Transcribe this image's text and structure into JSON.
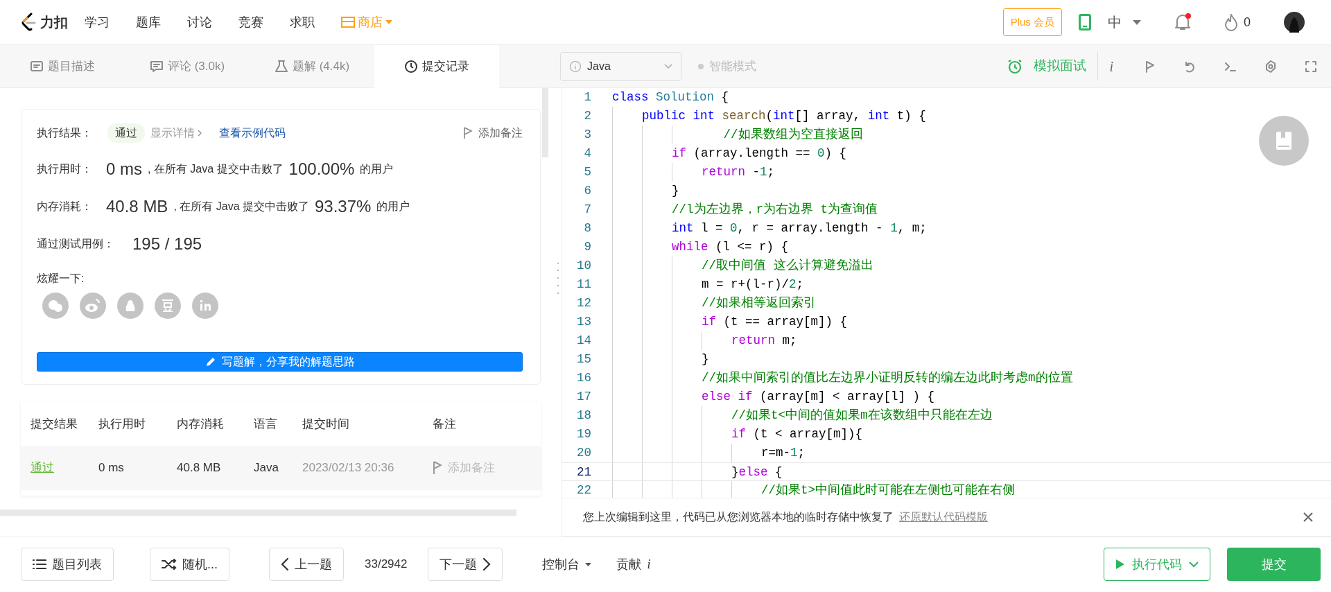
{
  "nav": {
    "logo_text": "力扣",
    "links": [
      {
        "label": "学习"
      },
      {
        "label": "题库"
      },
      {
        "label": "讨论"
      },
      {
        "label": "竞赛"
      },
      {
        "label": "求职"
      }
    ],
    "store": "商店",
    "plus": "Plus 会员",
    "lang": {
      "label": "中",
      "expanded": false
    },
    "bell_unread": true,
    "fire_count": "0"
  },
  "left_tabs": [
    {
      "label": "题目描述",
      "selected": false
    },
    {
      "label": "评论 (3.0k)",
      "selected": false
    },
    {
      "label": "题解 (4.4k)",
      "selected": false
    },
    {
      "label": "提交记录",
      "selected": true
    }
  ],
  "editor_toolbar": {
    "language": "Java",
    "smart_mode": "智能模式",
    "interview": "模拟面试",
    "info": "i"
  },
  "result": {
    "status_label": "执行结果：",
    "status": "通过",
    "details": "显示详情",
    "sample_link": "查看示例代码",
    "note": "添加备注",
    "runtime": {
      "label": "执行用时：",
      "value": "0 ms",
      "text": ", 在所有 Java 提交中击败了",
      "percent": "100.00%",
      "suffix": "的用户"
    },
    "memory": {
      "label": "内存消耗：",
      "value": "40.8 MB",
      "text": ", 在所有 Java 提交中击败了",
      "percent": "93.37%",
      "suffix": "的用户"
    },
    "tests": {
      "label": "通过测试用例：",
      "value": "195 / 195"
    },
    "share_label": "炫耀一下:",
    "write_button": "写题解，分享我的解题思路"
  },
  "submissions": {
    "columns": [
      "提交结果",
      "执行用时",
      "内存消耗",
      "语言",
      "提交时间",
      "备注"
    ],
    "rows": [
      {
        "result": "通过",
        "runtime": "0 ms",
        "memory": "40.8 MB",
        "language": "Java",
        "time": "2023/02/13 20:36",
        "note": "添加备注"
      }
    ]
  },
  "code": {
    "lines": [
      {
        "number": "1",
        "current": false,
        "tokens": [
          {
            "kind": "keyword",
            "text": "class"
          },
          {
            "kind": "type",
            "text": " Solution"
          },
          {
            "kind": "plain",
            "text": " {"
          }
        ]
      },
      {
        "number": "2",
        "current": false,
        "tokens": [
          {
            "kind": "keyword",
            "text": "    public"
          },
          {
            "kind": "keyword",
            "text": " int"
          },
          {
            "kind": "function",
            "text": " search"
          },
          {
            "kind": "plain",
            "text": "("
          },
          {
            "kind": "keyword",
            "text": "int"
          },
          {
            "kind": "plain",
            "text": "[] array, "
          },
          {
            "kind": "keyword",
            "text": "int"
          },
          {
            "kind": "plain",
            "text": " t) {"
          }
        ]
      },
      {
        "number": "3",
        "current": false,
        "tokens": [
          {
            "kind": "comment",
            "text": "               //如果数组为空直接返回"
          }
        ]
      },
      {
        "number": "4",
        "current": false,
        "tokens": [
          {
            "kind": "control",
            "text": "        if"
          },
          {
            "kind": "plain",
            "text": " (array.length == "
          },
          {
            "kind": "number",
            "text": "0"
          },
          {
            "kind": "plain",
            "text": ") {"
          }
        ]
      },
      {
        "number": "5",
        "current": false,
        "tokens": [
          {
            "kind": "control",
            "text": "            return"
          },
          {
            "kind": "plain",
            "text": " -"
          },
          {
            "kind": "number",
            "text": "1"
          },
          {
            "kind": "plain",
            "text": ";"
          }
        ]
      },
      {
        "number": "6",
        "current": false,
        "tokens": [
          {
            "kind": "plain",
            "text": "        }"
          }
        ]
      },
      {
        "number": "7",
        "current": false,
        "tokens": [
          {
            "kind": "comment",
            "text": "        //l为左边界，r为右边界 t为查询值"
          }
        ]
      },
      {
        "number": "8",
        "current": false,
        "tokens": [
          {
            "kind": "keyword",
            "text": "        int"
          },
          {
            "kind": "plain",
            "text": " l = "
          },
          {
            "kind": "number",
            "text": "0"
          },
          {
            "kind": "plain",
            "text": ", r = array.length - "
          },
          {
            "kind": "number",
            "text": "1"
          },
          {
            "kind": "plain",
            "text": ", m;"
          }
        ]
      },
      {
        "number": "9",
        "current": false,
        "tokens": [
          {
            "kind": "control",
            "text": "        while"
          },
          {
            "kind": "plain",
            "text": " (l <= r) {"
          }
        ]
      },
      {
        "number": "10",
        "current": false,
        "tokens": [
          {
            "kind": "comment",
            "text": "            //取中间值 这么计算避免溢出"
          }
        ]
      },
      {
        "number": "11",
        "current": false,
        "tokens": [
          {
            "kind": "plain",
            "text": "            m = r+(l-r)/"
          },
          {
            "kind": "number",
            "text": "2"
          },
          {
            "kind": "plain",
            "text": ";"
          }
        ]
      },
      {
        "number": "12",
        "current": false,
        "tokens": [
          {
            "kind": "comment",
            "text": "            //如果相等返回索引"
          }
        ]
      },
      {
        "number": "13",
        "current": false,
        "tokens": [
          {
            "kind": "control",
            "text": "            if"
          },
          {
            "kind": "plain",
            "text": " (t == array[m]) {"
          }
        ]
      },
      {
        "number": "14",
        "current": false,
        "tokens": [
          {
            "kind": "control",
            "text": "                return"
          },
          {
            "kind": "plain",
            "text": " m;"
          }
        ]
      },
      {
        "number": "15",
        "current": false,
        "tokens": [
          {
            "kind": "plain",
            "text": "            }"
          }
        ]
      },
      {
        "number": "16",
        "current": false,
        "tokens": [
          {
            "kind": "comment",
            "text": "            //如果中间索引的值比左边界小证明反转的编左边此时考虑m的位置"
          }
        ]
      },
      {
        "number": "17",
        "current": false,
        "tokens": [
          {
            "kind": "control",
            "text": "            else"
          },
          {
            "kind": "control",
            "text": " if"
          },
          {
            "kind": "plain",
            "text": " (array[m] < array[l] ) {"
          }
        ]
      },
      {
        "number": "18",
        "current": false,
        "tokens": [
          {
            "kind": "comment",
            "text": "                //如果t<中间的值如果m在该数组中只能在左边"
          }
        ]
      },
      {
        "number": "19",
        "current": false,
        "tokens": [
          {
            "kind": "control",
            "text": "                if"
          },
          {
            "kind": "plain",
            "text": " (t < array[m]){"
          }
        ]
      },
      {
        "number": "20",
        "current": false,
        "tokens": [
          {
            "kind": "plain",
            "text": "                    r=m-"
          },
          {
            "kind": "number",
            "text": "1"
          },
          {
            "kind": "plain",
            "text": ";"
          }
        ]
      },
      {
        "number": "21",
        "current": true,
        "tokens": [
          {
            "kind": "plain",
            "text": "                }"
          },
          {
            "kind": "control",
            "text": "else"
          },
          {
            "kind": "plain",
            "text": " {"
          }
        ]
      },
      {
        "number": "22",
        "current": false,
        "tokens": [
          {
            "kind": "comment",
            "text": "                    //如果t>中间值此时可能在左侧也可能在右侧"
          }
        ]
      }
    ]
  },
  "restore_notice": {
    "text": "您上次编辑到这里，代码已从您浏览器本地的临时存储中恢复了",
    "link": "还原默认代码模版"
  },
  "bottom": {
    "list": "题目列表",
    "random": "随机...",
    "prev": "上一题",
    "position": "33/2942",
    "next": "下一题",
    "console": "控制台",
    "contribute": "贡献",
    "contribute_info": "i",
    "run": "执行代码",
    "submit": "提交"
  }
}
